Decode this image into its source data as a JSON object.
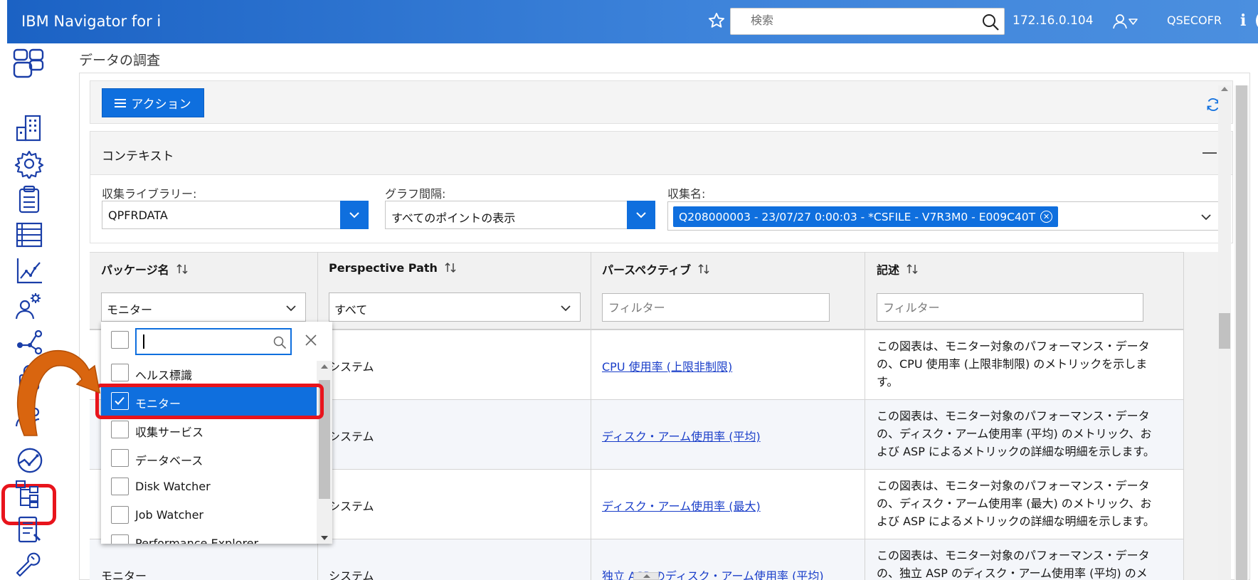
{
  "header": {
    "app_title": "IBM Navigator for i",
    "search_placeholder": "検索",
    "host": "172.16.0.104",
    "user": "QSECOFR",
    "info_label": "i"
  },
  "nav": {
    "items": [
      "dashboard-icon",
      "system-icon",
      "settings-icon",
      "clipboard-icon",
      "list-icon",
      "chart-icon",
      "user-gear-icon",
      "network-icon",
      "lock-icon",
      "users-icon",
      "performance-icon",
      "hierarchy-icon",
      "document-icon",
      "wrench-icon"
    ],
    "active": "performance-icon"
  },
  "page": {
    "title": "データの調査",
    "actions_label": "アクション"
  },
  "context": {
    "title": "コンテキスト",
    "library_label": "収集ライブラリー:",
    "library_value": "QPFRDATA",
    "interval_label": "グラフ間隔:",
    "interval_value": "すべてのポイントの表示",
    "collection_label": "収集名:",
    "collection_value": "Q208000003 - 23/07/27 0:00:03 - *CSFILE - V7R3M0 - E009C40T"
  },
  "table": {
    "columns": [
      "パッケージ名",
      "Perspective Path",
      "パースペクティブ",
      "記述"
    ],
    "filters": {
      "package": "モニター",
      "path": "すべて",
      "perspective_placeholder": "フィルター",
      "description_placeholder": "フィルター"
    },
    "rows": [
      {
        "package": "",
        "path": "システム",
        "perspective": "CPU 使用率 (上限非制限)",
        "description": [
          "この図表は、モニター対象のパフォーマンス・データ",
          "の、CPU 使用率 (上限非制限) のメトリックを示しま",
          "す。"
        ]
      },
      {
        "package": "",
        "path": "システム",
        "perspective": "ディスク・アーム使用率 (平均)",
        "description": [
          "この図表は、モニター対象のパフォーマンス・データ",
          "の、ディスク・アーム使用率 (平均) のメトリック、お",
          "よび ASP によるメトリックの詳細な明細を示します。"
        ]
      },
      {
        "package": "",
        "path": "システム",
        "perspective": "ディスク・アーム使用率 (最大)",
        "description": [
          "この図表は、モニター対象のパフォーマンス・データ",
          "の、ディスク・アーム使用率 (最大) のメトリック、お",
          "よび ASP によるメトリックの詳細な明細を示します。"
        ]
      },
      {
        "package": "モニター",
        "path": "システム",
        "perspective": "独立 ASP のディスク・アーム使用率 (平均)",
        "description": [
          "この図表は、モニター対象のパフォーマンス・データ",
          "の、独立 ASP のディスク・アーム使用率 (平均) のメト"
        ]
      }
    ]
  },
  "dropdown": {
    "search_value": "",
    "items": [
      {
        "label": "ヘルス標識",
        "checked": false
      },
      {
        "label": "モニター",
        "checked": true
      },
      {
        "label": "収集サービス",
        "checked": false
      },
      {
        "label": "データベース",
        "checked": false
      },
      {
        "label": "Disk Watcher",
        "checked": false
      },
      {
        "label": "Job Watcher",
        "checked": false
      },
      {
        "label": "Performance Explorer",
        "checked": false
      }
    ]
  },
  "colors": {
    "header_blue": "#1b62c4",
    "primary_blue": "#0f6fde",
    "link_blue": "#1a3ec9",
    "annotation_red": "#e8141c",
    "annotation_orange": "#d9650f"
  }
}
